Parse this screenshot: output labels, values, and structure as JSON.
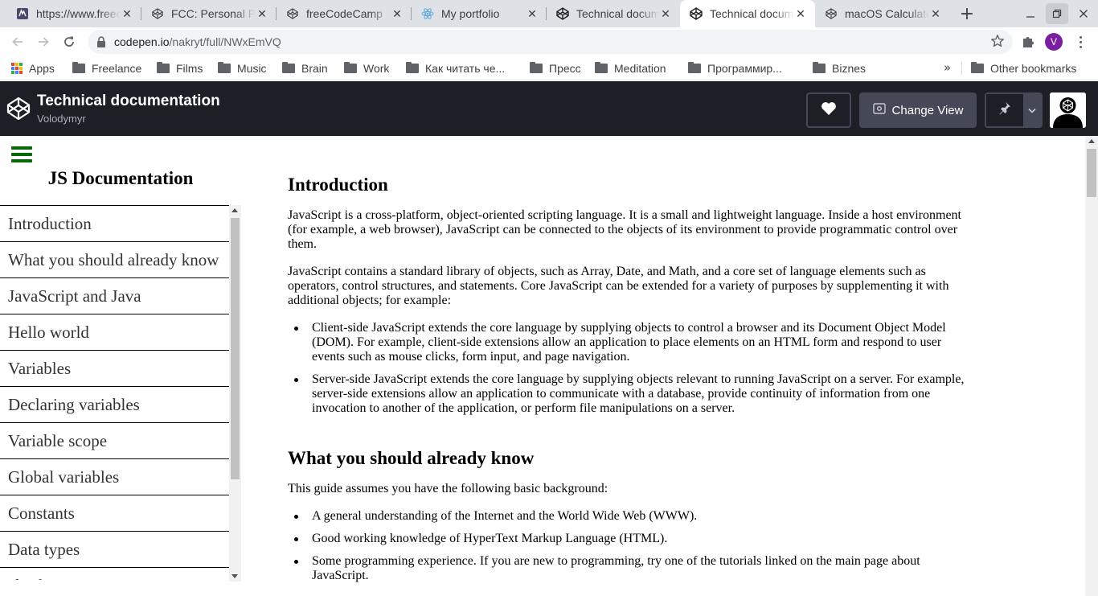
{
  "browser": {
    "tabs": [
      {
        "title": "https://www.freecodecamp.org",
        "icon": "freecodecamp-icon",
        "active": false
      },
      {
        "title": "FCC: Personal Portfolio",
        "icon": "codepen-icon",
        "active": false
      },
      {
        "title": "freeCodeCamp",
        "icon": "codepen-icon",
        "active": false
      },
      {
        "title": "My portfolio",
        "icon": "react-icon",
        "active": false
      },
      {
        "title": "Technical documentation",
        "icon": "codepen-icon",
        "active": false
      },
      {
        "title": "Technical documentation",
        "icon": "codepen-icon",
        "active": true
      },
      {
        "title": "macOS Calculator",
        "icon": "codepen-icon",
        "active": false
      }
    ],
    "url_host": "codepen.io",
    "url_path": "/nakryt/full/NWxEmVQ",
    "profile_initial": "V",
    "bookmarks": [
      "Apps",
      "Freelance",
      "Films",
      "Music",
      "Brain",
      "Work",
      "Как читать че...",
      "Пресс",
      "Meditation",
      "Программир...",
      "Biznes"
    ],
    "other_bookmarks": "Other bookmarks"
  },
  "codepen": {
    "title": "Technical documentation",
    "author": "Volodymyr",
    "change_view": "Change View"
  },
  "nav": {
    "header": "JS Documentation",
    "links": [
      "Introduction",
      "What you should already know",
      "JavaScript and Java",
      "Hello world",
      "Variables",
      "Declaring variables",
      "Variable scope",
      "Global variables",
      "Constants",
      "Data types",
      "if...else statement"
    ]
  },
  "doc": {
    "intro_title": "Introduction",
    "intro_p1": "JavaScript is a cross-platform, object-oriented scripting language. It is a small and lightweight language. Inside a host environment (for example, a web browser), JavaScript can be connected to the objects of its environment to provide programmatic control over them.",
    "intro_p2": "JavaScript contains a standard library of objects, such as Array, Date, and Math, and a core set of language elements such as operators, control structures, and statements. Core JavaScript can be extended for a variety of purposes by supplementing it with additional objects; for example:",
    "intro_list": [
      "Client-side JavaScript extends the core language by supplying objects to control a browser and its Document Object Model (DOM). For example, client-side extensions allow an application to place elements on an HTML form and respond to user events such as mouse clicks, form input, and page navigation.",
      "Server-side JavaScript extends the core language by supplying objects relevant to running JavaScript on a server. For example, server-side extensions allow an application to communicate with a database, provide continuity of information from one invocation to another of the application, or perform file manipulations on a server."
    ],
    "know_title": "What you should already know",
    "know_p1": "This guide assumes you have the following basic background:",
    "know_list": [
      "A general understanding of the Internet and the World Wide Web (WWW).",
      "Good working knowledge of HyperText Markup Language (HTML).",
      "Some programming experience. If you are new to programming, try one of the tutorials linked on the main page about JavaScript."
    ]
  }
}
